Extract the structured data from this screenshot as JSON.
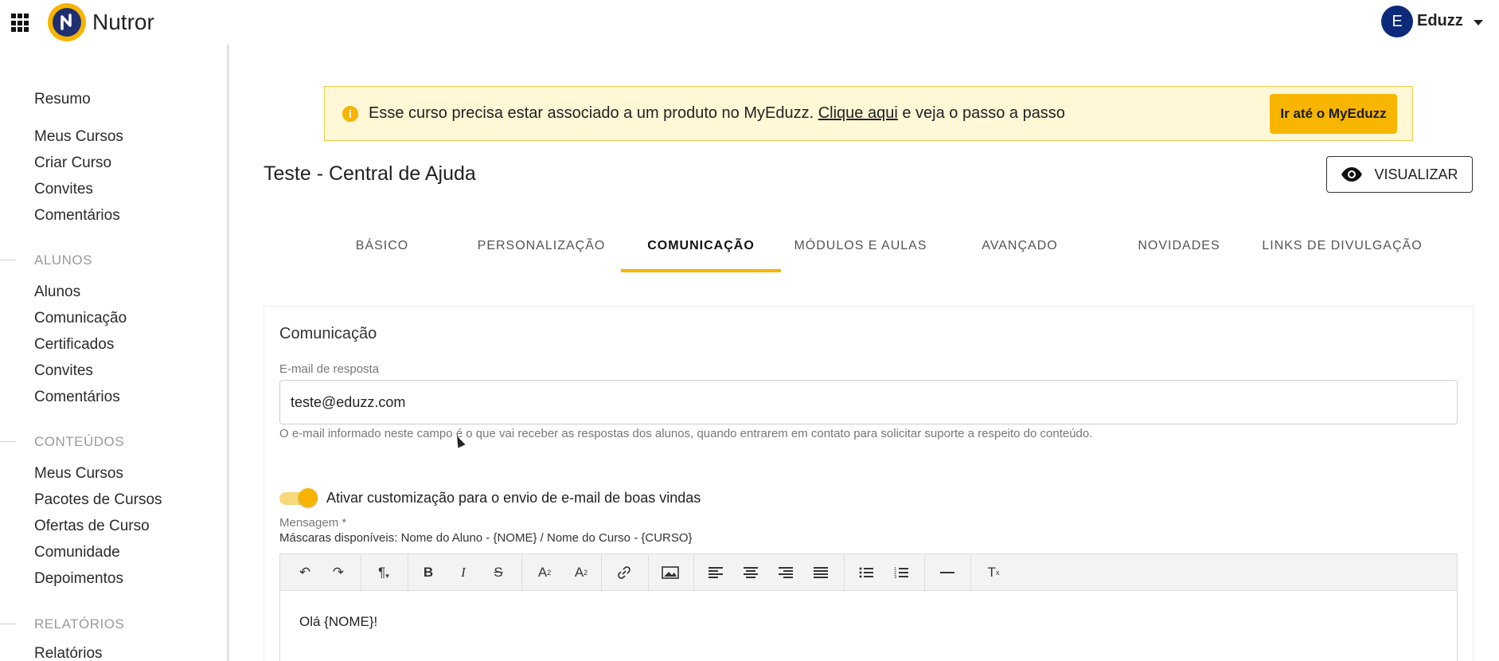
{
  "header": {
    "brand": "Nutror",
    "user_initial": "E",
    "user_name": "Eduzz"
  },
  "sidebar": {
    "items_top": [
      {
        "label": "Resumo"
      },
      {
        "label": "Meus Cursos"
      },
      {
        "label": "Criar Curso"
      },
      {
        "label": "Convites"
      },
      {
        "label": "Comentários"
      }
    ],
    "section_alunos": "ALUNOS",
    "items_alunos": [
      {
        "label": "Alunos"
      },
      {
        "label": "Comunicação"
      },
      {
        "label": "Certificados"
      },
      {
        "label": "Convites"
      },
      {
        "label": "Comentários"
      }
    ],
    "section_conteudos": "CONTEÚDOS",
    "items_conteudos": [
      {
        "label": "Meus Cursos"
      },
      {
        "label": "Pacotes de Cursos"
      },
      {
        "label": "Ofertas de Curso"
      },
      {
        "label": "Comunidade"
      },
      {
        "label": "Depoimentos"
      }
    ],
    "section_relatorios": "RELATÓRIOS",
    "items_relatorios": [
      {
        "label": "Relatórios"
      }
    ]
  },
  "banner": {
    "text_before": "Esse curso precisa estar associado a um produto no MyEduzz. ",
    "link": "Clique aqui",
    "text_after": " e veja o passo a passo",
    "button": "Ir até o MyEduzz"
  },
  "page": {
    "title": "Teste - Central de Ajuda",
    "view_button": "VISUALIZAR"
  },
  "tabs": [
    {
      "label": "BÁSICO"
    },
    {
      "label": "PERSONALIZAÇÃO"
    },
    {
      "label": "COMUNICAÇÃO",
      "active": true
    },
    {
      "label": "MÓDULOS E AULAS"
    },
    {
      "label": "AVANÇADO"
    },
    {
      "label": "NOVIDADES"
    },
    {
      "label": "LINKS DE DIVULGAÇÃO"
    }
  ],
  "form": {
    "section_title": "Comunicação",
    "email_label": "E-mail de resposta",
    "email_value": "teste@eduzz.com",
    "email_helper": "O e-mail informado neste campo é o que vai receber as respostas dos alunos, quando entrarem em contato para solicitar suporte a respeito do conteúdo.",
    "toggle_label": "Ativar customização para o envio de e-mail de boas vindas",
    "toggle_on": true,
    "message_label": "Mensagem *",
    "masks": "Máscaras disponíveis: Nome do Aluno - {NOME} / Nome do Curso - {CURSO}",
    "editor_text": "Olá {NOME}!"
  },
  "colors": {
    "accent": "#f6b400",
    "banner_bg": "#fff7d6",
    "avatar": "#0d2a7a",
    "logo_inner": "#1f2f72"
  }
}
